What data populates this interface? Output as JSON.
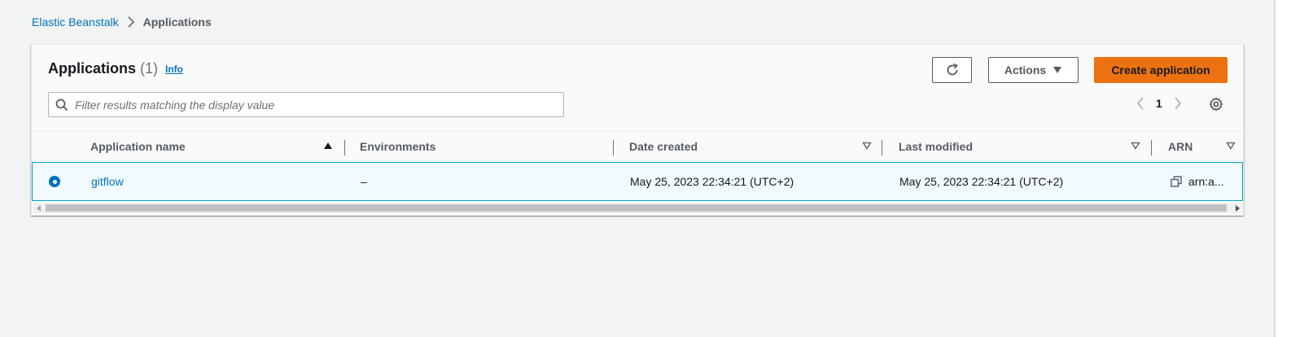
{
  "breadcrumb": {
    "parent": "Elastic Beanstalk",
    "current": "Applications"
  },
  "header": {
    "title": "Applications",
    "count": "(1)",
    "info_label": "Info",
    "actions_label": "Actions",
    "create_label": "Create application"
  },
  "search": {
    "placeholder": "Filter results matching the display value",
    "value": ""
  },
  "pagination": {
    "current_page": "1"
  },
  "table": {
    "columns": [
      {
        "label": "Application name"
      },
      {
        "label": "Environments"
      },
      {
        "label": "Date created"
      },
      {
        "label": "Last modified"
      },
      {
        "label": "ARN"
      }
    ],
    "rows": [
      {
        "name": "gitflow",
        "environments": "–",
        "date_created": "May 25, 2023 22:34:21 (UTC+2)",
        "last_modified": "May 25, 2023 22:34:21 (UTC+2)",
        "arn": "arn:a..."
      }
    ]
  },
  "icons": {
    "breadcrumb_separator": "chevron-right-icon",
    "refresh": "refresh-icon",
    "actions_caret": "caret-down-icon",
    "search": "search-icon",
    "prev_page": "chevron-left-icon",
    "next_page": "chevron-right-icon",
    "settings": "gear-icon",
    "sort_ascending": "sort-ascending-icon",
    "sort_unsorted": "sort-unsorted-icon",
    "copy": "copy-icon"
  },
  "colors": {
    "link": "#0073bb",
    "primary_button": "#ec7211",
    "selected_row_bg": "#f1faff",
    "selected_row_border": "#00a1c9"
  }
}
